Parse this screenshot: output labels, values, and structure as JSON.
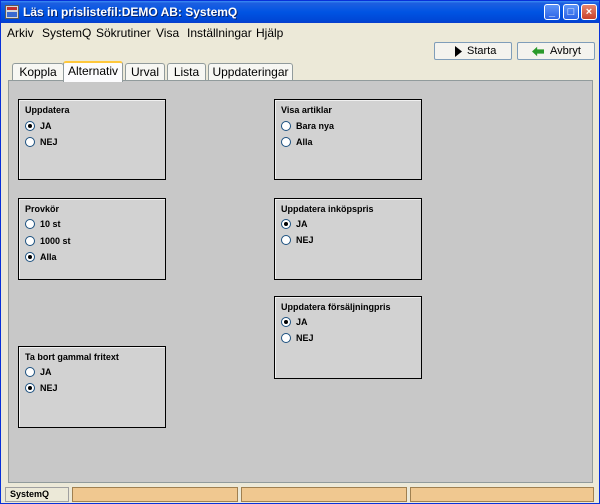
{
  "window": {
    "title": "Läs in prislistefil:DEMO AB: SystemQ",
    "controls": {
      "minimize": "_",
      "maximize": "□",
      "close": "×"
    }
  },
  "menu": [
    {
      "label": "Arkiv"
    },
    {
      "label": "SystemQ"
    },
    {
      "label": "Sökrutiner"
    },
    {
      "label": "Visa"
    },
    {
      "label": "Inställningar"
    },
    {
      "label": "Hjälp"
    }
  ],
  "toolbar": {
    "start_label": "Starta",
    "cancel_label": "Avbryt"
  },
  "tabs": [
    {
      "label": "Koppla",
      "active": false
    },
    {
      "label": "Alternativ",
      "active": true
    },
    {
      "label": "Urval",
      "active": false
    },
    {
      "label": "Lista",
      "active": false
    },
    {
      "label": "Uppdateringar",
      "active": false
    }
  ],
  "groups": {
    "uppdatera": {
      "title": "Uppdatera",
      "options": [
        {
          "label": "JA",
          "checked": true
        },
        {
          "label": "NEJ",
          "checked": false
        }
      ]
    },
    "provkor": {
      "title": "Provkör",
      "options": [
        {
          "label": "10 st",
          "checked": false
        },
        {
          "label": "1000 st",
          "checked": false
        },
        {
          "label": "Alla",
          "checked": true
        }
      ]
    },
    "ta_bort": {
      "title": "Ta bort gammal fritext",
      "options": [
        {
          "label": "JA",
          "checked": false
        },
        {
          "label": "NEJ",
          "checked": true
        }
      ]
    },
    "visa_artiklar": {
      "title": "Visa artiklar",
      "options": [
        {
          "label": "Bara nya",
          "checked": false
        },
        {
          "label": "Alla",
          "checked": false
        }
      ]
    },
    "inkopspris": {
      "title": "Uppdatera inköpspris",
      "options": [
        {
          "label": "JA",
          "checked": true
        },
        {
          "label": "NEJ",
          "checked": false
        }
      ]
    },
    "forsaljningspris": {
      "title": "Uppdatera försäljningpris",
      "options": [
        {
          "label": "JA",
          "checked": true
        },
        {
          "label": "NEJ",
          "checked": false
        }
      ]
    }
  },
  "status": {
    "app": "SystemQ",
    "cells": [
      "",
      "",
      "",
      ""
    ]
  },
  "colors": {
    "accent": "#0054e3",
    "panel": "#c8c8c8",
    "status_cell": "#f0c890",
    "start_arrow": "#000000",
    "cancel_arrow": "#2a9a2a"
  }
}
